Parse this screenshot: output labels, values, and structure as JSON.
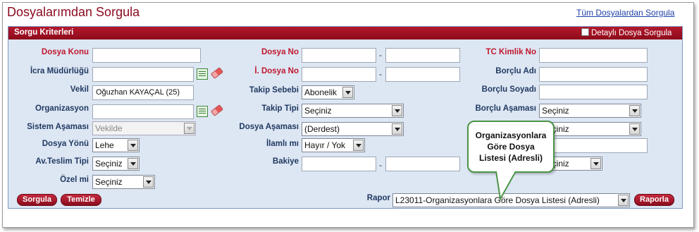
{
  "page": {
    "title": "Dosyalarımdan Sorgula",
    "all_files_link": "Tüm Dosyalardan Sorgula"
  },
  "panel": {
    "title": "Sorgu Kriterleri",
    "detail_checkbox_label": "Detaylı Dosya Sorgula",
    "detail_checked": false
  },
  "col1": {
    "dosya_konu_label": "Dosya Konu",
    "dosya_konu_value": "",
    "icra_mudurlugu_label": "İcra Müdürlüğü",
    "icra_mudurlugu_value": "",
    "vekil_label": "Vekil",
    "vekil_value": "Oğuzhan KAYAÇAL (25)",
    "organizasyon_label": "Organizasyon",
    "organizasyon_value": "",
    "sistem_asamasi_label": "Sistem Aşaması",
    "sistem_asamasi_value": "Vekilde",
    "dosya_yonu_label": "Dosya Yönü",
    "dosya_yonu_value": "Lehe",
    "av_teslim_tipi_label": "Av.Teslim Tipi",
    "av_teslim_tipi_value": "Seçiniz",
    "ozel_mi_label": "Özel mi",
    "ozel_mi_value": "Seçiniz"
  },
  "col2": {
    "dosya_no_label": "Dosya No",
    "dosya_no_from": "",
    "dosya_no_to": "",
    "i_dosya_no_label": "İ. Dosya No",
    "i_dosya_no_from": "",
    "i_dosya_no_to": "",
    "takip_sebebi_label": "Takip Sebebi",
    "takip_sebebi_value": "Abonelik",
    "takip_tipi_label": "Takip Tipi",
    "takip_tipi_value": "Seçiniz",
    "dosya_asamasi_label": "Dosya Aşaması",
    "dosya_asamasi_value": "(Derdest)",
    "ilamli_mi_label": "İlamlı mı",
    "ilamli_mi_value": "Hayır / Yok",
    "bakiye_label": "Bakiye",
    "bakiye_from": "",
    "bakiye_to": "",
    "dash": "-"
  },
  "col3": {
    "tc_kimlik_no_label": "TC Kimlik No",
    "tc_kimlik_no_value": "",
    "borclu_adi_label": "Borçlu Adı",
    "borclu_adi_value": "",
    "borclu_soyadi_label": "Borçlu Soyadı",
    "borclu_soyadi_value": "",
    "borclu_asamasi_label": "Borçlu Aşaması",
    "borclu_asamasi_value": "Seçiniz",
    "row5_select_value": "Seçiniz",
    "row6_label_partial": "İ",
    "row7_select_value": "Seçiniz"
  },
  "footer": {
    "sorgula_button": "Sorgula",
    "temizle_button": "Temizle",
    "rapor_label": "Rapor",
    "rapor_value": "L23011-Organizasyonlara Göre Dosya Listesi (Adresli)",
    "raporla_button": "Raporla"
  },
  "tooltip": {
    "line1": "Organizasyonlara",
    "line2": "Göre Dosya",
    "line3": "Listesi (Adresli)"
  },
  "colors": {
    "title_red": "#8b0a1e",
    "header_red": "#a31426",
    "panel_bg": "#dde6f3",
    "label_blue": "#203a62",
    "label_red": "#c0182f",
    "tooltip_border": "#4a9447"
  }
}
